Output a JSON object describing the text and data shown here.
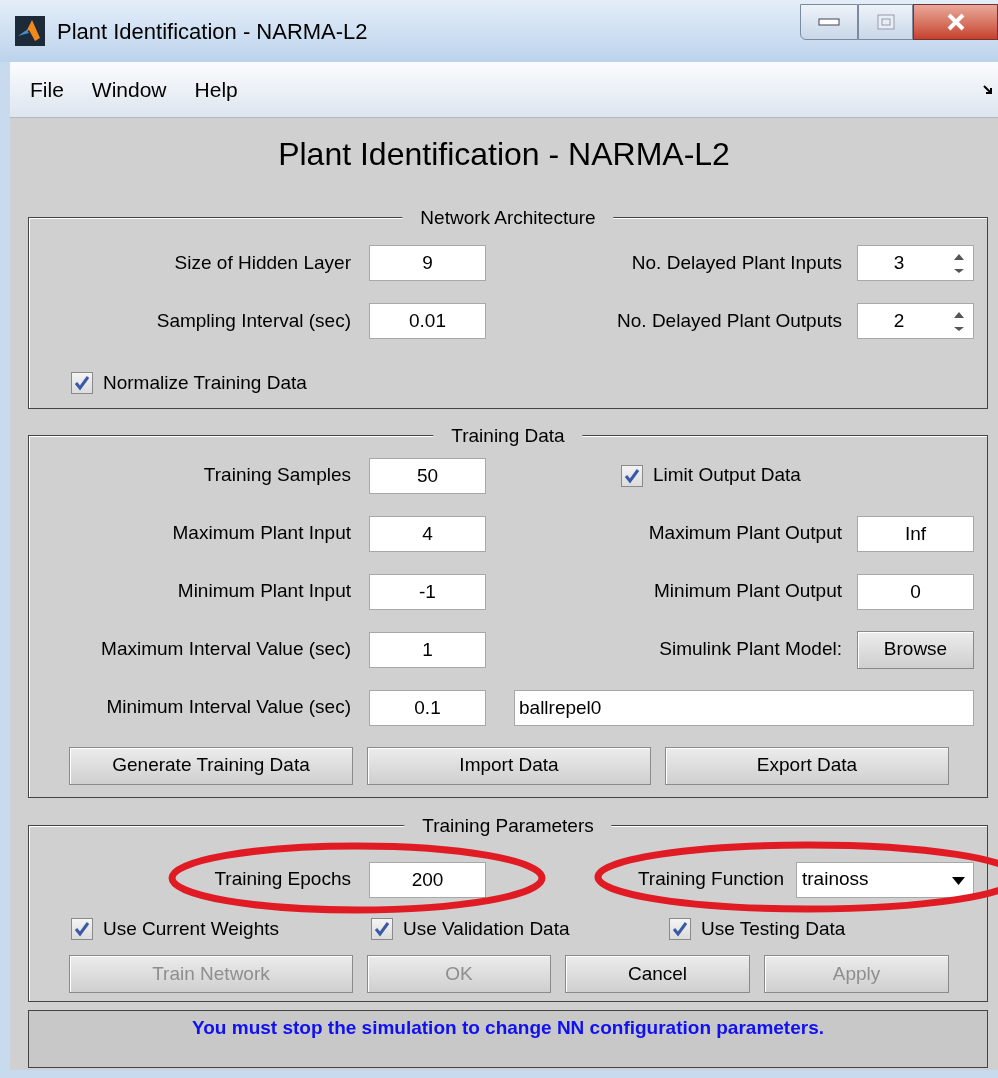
{
  "window": {
    "title": "Plant Identification - NARMA-L2"
  },
  "menu": [
    "File",
    "Window",
    "Help"
  ],
  "heading": "Plant Identification - NARMA-L2",
  "network_architecture": {
    "title": "Network Architecture",
    "rows": [
      {
        "left": {
          "label": "Size of Hidden Layer",
          "value": "9"
        },
        "right": {
          "kind": "spinner",
          "label": "No. Delayed Plant Inputs",
          "value": "3"
        }
      },
      {
        "left": {
          "label": "Sampling Interval (sec)",
          "value": "0.01"
        },
        "right": {
          "kind": "spinner",
          "label": "No. Delayed Plant Outputs",
          "value": "2"
        }
      }
    ],
    "checkbox": {
      "label": "Normalize Training Data",
      "checked": true
    }
  },
  "training_data": {
    "title": "Training Data",
    "rows": [
      {
        "left": {
          "label": "Training Samples",
          "value": "50"
        },
        "right": {
          "kind": "checkbox",
          "label": "Limit Output Data",
          "checked": true
        }
      },
      {
        "left": {
          "label": "Maximum Plant Input",
          "value": "4"
        },
        "right": {
          "kind": "field",
          "label": "Maximum Plant Output",
          "value": "Inf"
        }
      },
      {
        "left": {
          "label": "Minimum Plant Input",
          "value": "-1"
        },
        "right": {
          "kind": "field",
          "label": "Minimum Plant Output",
          "value": "0"
        }
      },
      {
        "left": {
          "label": "Maximum Interval Value (sec)",
          "value": "1"
        },
        "right": {
          "kind": "button",
          "label": "Simulink Plant Model:",
          "button": "Browse"
        }
      },
      {
        "left": {
          "label": "Minimum Interval Value (sec)",
          "value": "0.1"
        },
        "right": {
          "kind": "text_field",
          "value": "ballrepel0"
        }
      }
    ],
    "buttons": [
      {
        "label": "Generate Training Data",
        "disabled": false
      },
      {
        "label": "Import Data",
        "disabled": false
      },
      {
        "label": "Export Data",
        "disabled": false
      }
    ]
  },
  "training_parameters": {
    "title": "Training Parameters",
    "epochs": {
      "label": "Training Epochs",
      "value": "200"
    },
    "function": {
      "label": "Training Function",
      "value": "trainoss"
    },
    "checkboxes": [
      {
        "label": "Use Current Weights",
        "checked": true
      },
      {
        "label": "Use Validation Data",
        "checked": true
      },
      {
        "label": "Use Testing Data",
        "checked": true
      }
    ],
    "buttons": [
      {
        "label": "Train Network",
        "disabled": true
      },
      {
        "label": "OK",
        "disabled": true
      },
      {
        "label": "Cancel",
        "disabled": false
      },
      {
        "label": "Apply",
        "disabled": true
      }
    ]
  },
  "status": "You must stop the simulation to change NN configuration parameters."
}
